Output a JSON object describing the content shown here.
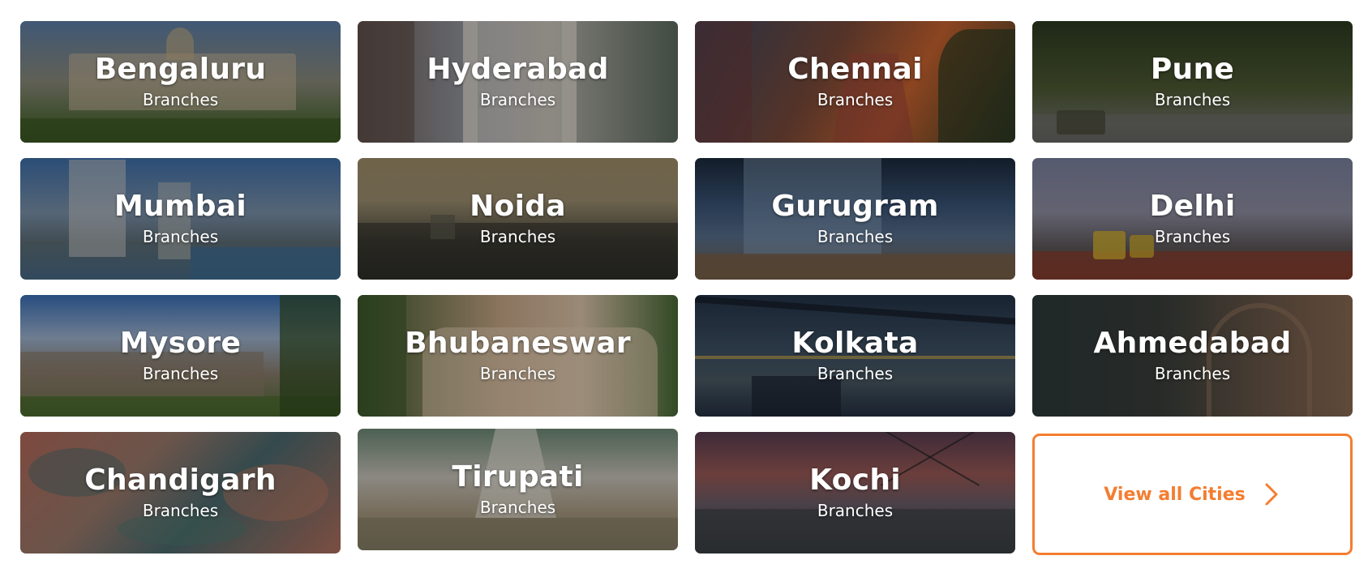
{
  "cards": [
    {
      "city": "Bengaluru",
      "sub": "Branches"
    },
    {
      "city": "Hyderabad",
      "sub": "Branches"
    },
    {
      "city": "Chennai",
      "sub": "Branches"
    },
    {
      "city": "Pune",
      "sub": "Branches"
    },
    {
      "city": "Mumbai",
      "sub": "Branches"
    },
    {
      "city": "Noida",
      "sub": "Branches"
    },
    {
      "city": "Gurugram",
      "sub": "Branches"
    },
    {
      "city": "Delhi",
      "sub": "Branches"
    },
    {
      "city": "Mysore",
      "sub": "Branches"
    },
    {
      "city": "Bhubaneswar",
      "sub": "Branches"
    },
    {
      "city": "Kolkata",
      "sub": "Branches"
    },
    {
      "city": "Ahmedabad",
      "sub": "Branches"
    },
    {
      "city": "Chandigarh",
      "sub": "Branches"
    },
    {
      "city": "Tirupati",
      "sub": "Branches"
    },
    {
      "city": "Kochi",
      "sub": "Branches"
    }
  ],
  "view_all": {
    "label": "View all Cities",
    "icon": "chevron-right-icon",
    "accent_color": "#f47d30"
  }
}
